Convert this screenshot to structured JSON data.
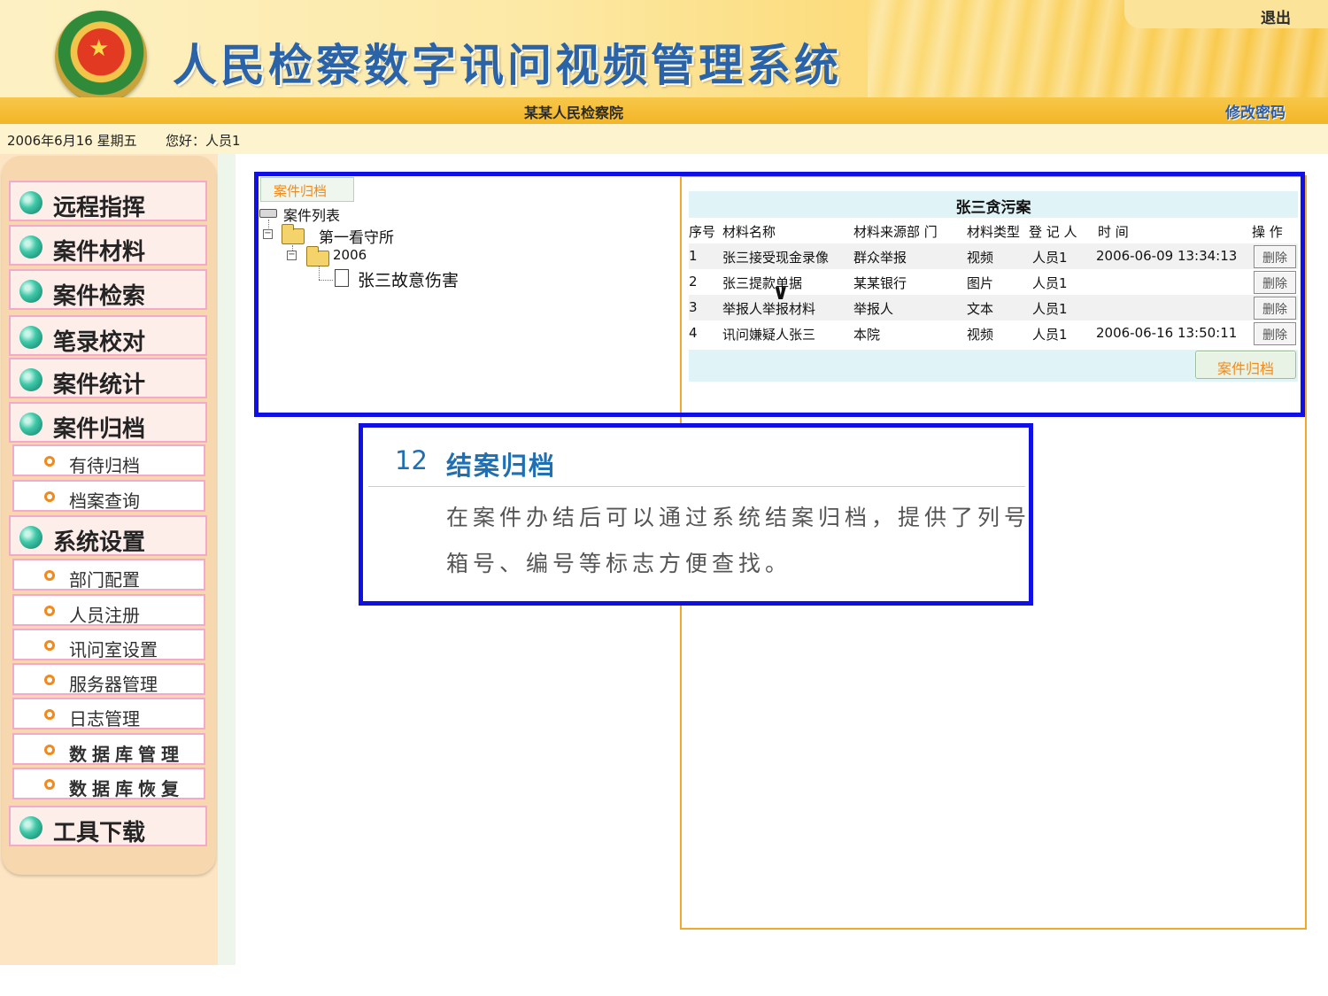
{
  "header": {
    "title": "人民检察数字讯问视频管理系统",
    "logout_label": "退出",
    "organization": "某某人民检察院",
    "change_password_label": "修改密码"
  },
  "infobar": {
    "date": "2006年6月16 星期五",
    "greeting": "您好：人员1"
  },
  "sidebar": {
    "items": [
      {
        "label": "远程指挥",
        "type": "main"
      },
      {
        "label": "案件材料",
        "type": "main"
      },
      {
        "label": "案件检索",
        "type": "main"
      },
      {
        "label": "笔录校对",
        "type": "main"
      },
      {
        "label": "案件统计",
        "type": "main"
      },
      {
        "label": "案件归档",
        "type": "main"
      },
      {
        "label": "有待归档",
        "type": "sub"
      },
      {
        "label": "档案查询",
        "type": "sub"
      },
      {
        "label": "系统设置",
        "type": "main"
      },
      {
        "label": "部门配置",
        "type": "sub"
      },
      {
        "label": "人员注册",
        "type": "sub"
      },
      {
        "label": "讯问室设置",
        "type": "sub"
      },
      {
        "label": "服务器管理",
        "type": "sub"
      },
      {
        "label": "日志管理",
        "type": "sub"
      },
      {
        "label": "数据库管理",
        "type": "sub"
      },
      {
        "label": "数据库恢复",
        "type": "sub"
      },
      {
        "label": "工具下载",
        "type": "main"
      }
    ]
  },
  "tree": {
    "tab_label": "案件归档",
    "root": "案件列表",
    "node1": "第一看守所",
    "node2": "2006",
    "leaf": "张三故意伤害"
  },
  "table": {
    "title": "张三贪污案",
    "headers": {
      "seq": "序号",
      "name": "材料名称",
      "source": "材料来源部 门",
      "type": "材料类型",
      "registrant": "登 记 人",
      "time": "时 间",
      "action": "操 作"
    },
    "rows": [
      {
        "seq": "1",
        "name": "张三接受现金录像",
        "source": "群众举报",
        "type": "视频",
        "registrant": "人员1",
        "time": "2006-06-09 13:34:13"
      },
      {
        "seq": "2",
        "name": "张三提款单据",
        "source": "某某银行",
        "type": "图片",
        "registrant": "人员1",
        "time": ""
      },
      {
        "seq": "3",
        "name": "举报人举报材料",
        "source": "举报人",
        "type": "文本",
        "registrant": "人员1",
        "time": ""
      },
      {
        "seq": "4",
        "name": "讯问嫌疑人张三",
        "source": "本院",
        "type": "视频",
        "registrant": "人员1",
        "time": "2006-06-16 13:50:11"
      }
    ],
    "delete_label": "删除",
    "archive_button": "案件归档"
  },
  "note": {
    "number": "12",
    "title": "结案归档",
    "line1": "在案件办结后可以通过系统结案归档，提供了列号",
    "line2": "箱号、编号等标志方便查找。"
  },
  "colors": {
    "accent_blue": "#1010e6",
    "title_blue": "#2a63a8",
    "orange": "#f08a1c",
    "frame_orange": "#f2a72d"
  }
}
